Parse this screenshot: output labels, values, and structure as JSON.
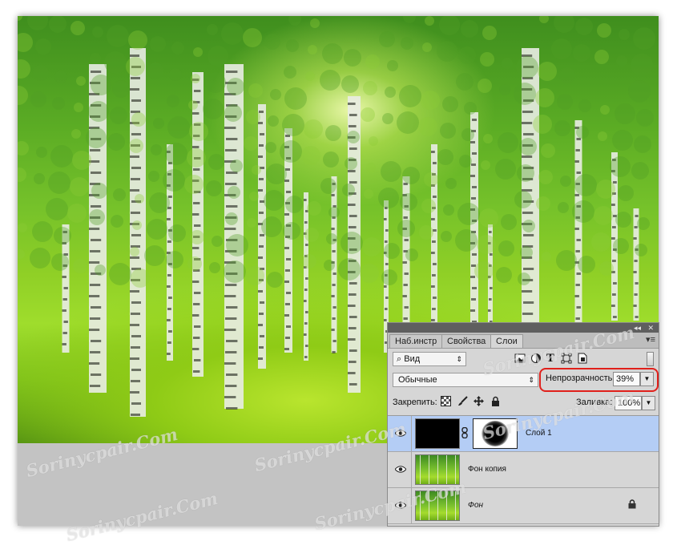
{
  "panel": {
    "collapse_icon": "double-chevron-icon",
    "close_icon": "close-icon",
    "tabs": [
      {
        "label": "Наб.инстр",
        "active": false
      },
      {
        "label": "Свойства",
        "active": false
      },
      {
        "label": "Слои",
        "active": true
      }
    ],
    "filter": {
      "label": "Вид",
      "icon": "search-icon"
    },
    "filter_icons": [
      "image-filter-icon",
      "adjustment-filter-icon",
      "type-filter-icon",
      "shape-filter-icon",
      "smart-object-filter-icon"
    ],
    "blend_mode": "Обычные",
    "opacity": {
      "label": "Непрозрачность:",
      "value": "39%"
    },
    "lock": {
      "label": "Закрепить:",
      "icons": [
        "lock-transparent-icon",
        "lock-brush-icon",
        "lock-move-icon",
        "lock-all-icon"
      ]
    },
    "fill": {
      "label": "Заливка:",
      "value": "100%"
    },
    "layers": [
      {
        "name": "Слой 1",
        "selected": true,
        "visible": true,
        "has_mask": true,
        "thumb": "black"
      },
      {
        "name": "Фон копия",
        "selected": false,
        "visible": true,
        "has_mask": false,
        "thumb": "forest"
      },
      {
        "name": "Фон",
        "selected": false,
        "visible": true,
        "has_mask": false,
        "thumb": "forest",
        "locked": true
      }
    ]
  },
  "watermark": "Sorinycpair.Com",
  "colors": {
    "selection": "#b4cdf5",
    "highlight": "#e0201b"
  }
}
